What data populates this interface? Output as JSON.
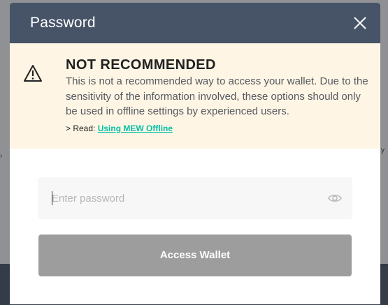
{
  "modal": {
    "title": "Password"
  },
  "warning": {
    "heading": "NOT RECOMMENDED",
    "body": "This is not a recommended way to access your wallet. Due to the sensitivity of the information involved, these options should only be used in offline settings by experienced users.",
    "read_prefix": "> Read: ",
    "link_label": "Using MEW Offline",
    "icon": "warning-triangle-icon"
  },
  "password": {
    "placeholder": "Enter password",
    "value": "",
    "icon": "eye-icon"
  },
  "access_button": {
    "label": "Access Wallet"
  },
  "colors": {
    "header_bg": "#475468",
    "warning_bg": "#fef5e5",
    "link": "#05c0a5",
    "button_disabled": "#9d9d9d"
  }
}
